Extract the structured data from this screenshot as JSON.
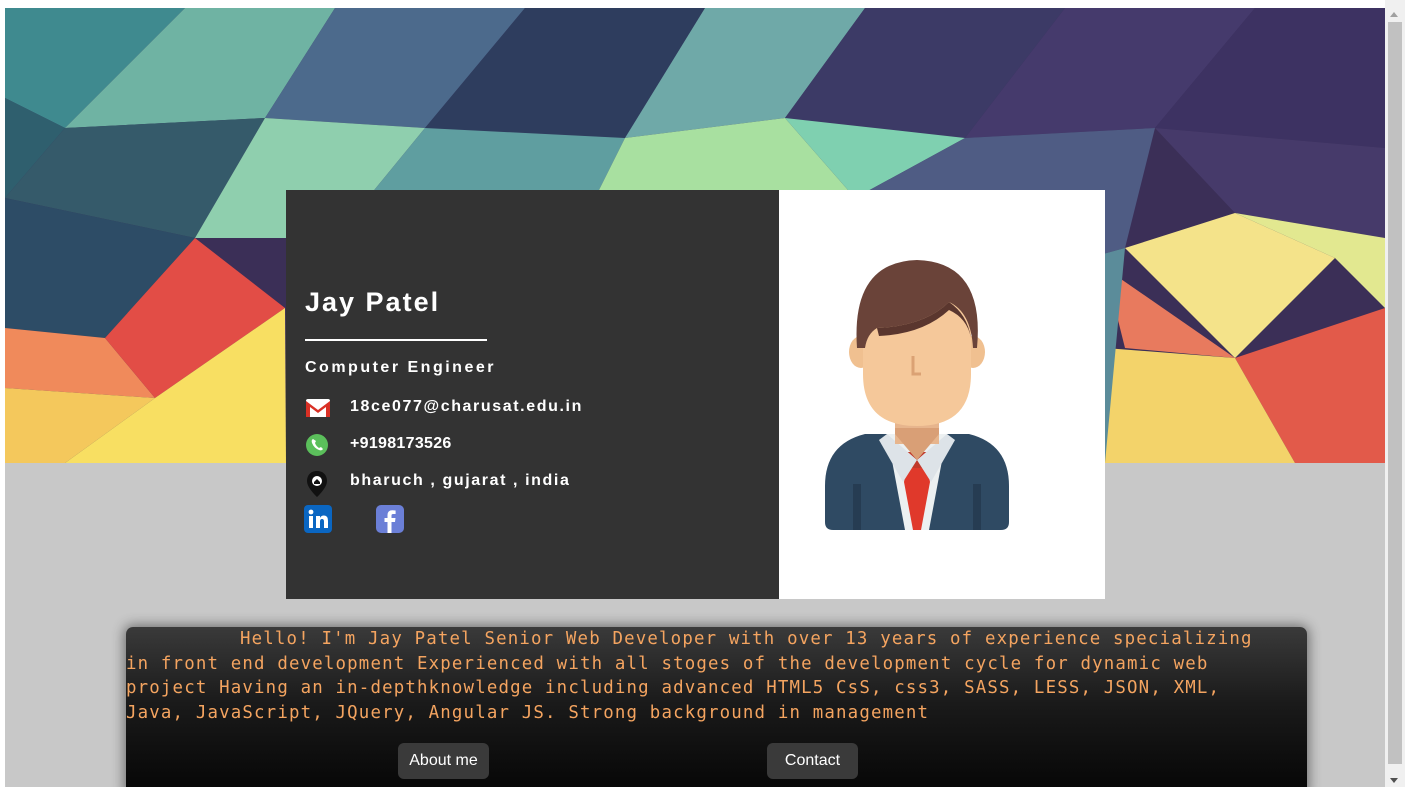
{
  "profile": {
    "name": "Jay Patel",
    "title": "Computer Engineer",
    "email": "18ce077@charusat.edu.in",
    "phone": "+9198173526",
    "location": "bharuch , gujarat , india",
    "social": [
      "linkedin-icon",
      "facebook-icon"
    ]
  },
  "about": {
    "text": "Hello! I'm Jay Patel Senior Web Developer with over 13 years of experience specializing in front end development Experienced with all stoges of the development cycle for dynamic web project Having an in-depthknowledge including advanced HTML5 CsS, css3, SASS, LESS, JSON, XML, Java, JavaScript, JQuery, Angular JS. Strong background in management",
    "about_button": "About me",
    "contact_button": "Contact"
  },
  "colors": {
    "page_bg": "#c8c8c8",
    "card_dark": "#333333",
    "about_text": "#f4a460"
  }
}
